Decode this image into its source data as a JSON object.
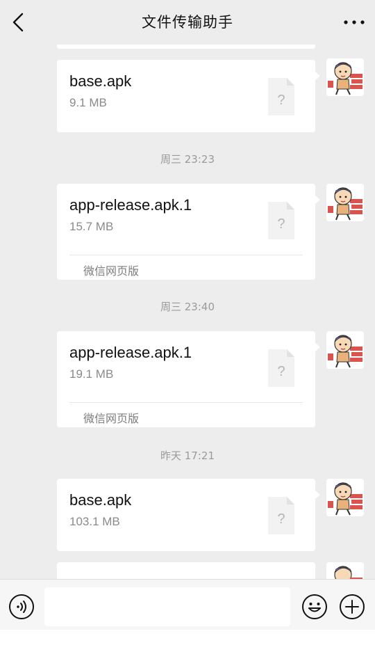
{
  "header": {
    "title": "文件传输助手",
    "back_icon": "chevron-left-icon",
    "more_icon": "more-dots-icon"
  },
  "messages": [
    {
      "file_name": "base.apk",
      "file_size": "9.1 MB",
      "source": ""
    },
    {
      "timestamp": "周三 23:23",
      "file_name": "app-release.apk.1",
      "file_size": "15.7 MB",
      "source": "微信网页版"
    },
    {
      "timestamp": "周三 23:40",
      "file_name": "app-release.apk.1",
      "file_size": "19.1 MB",
      "source": "微信网页版"
    },
    {
      "timestamp": "昨天 17:21",
      "file_name": "base.apk",
      "file_size": "103.1 MB",
      "source": ""
    }
  ],
  "file_icon_glyph": "?",
  "input_bar": {
    "voice_icon": "voice-icon",
    "emoji_icon": "emoji-icon",
    "plus_icon": "plus-circle-icon"
  },
  "colors": {
    "background": "#ededed",
    "bubble": "#ffffff",
    "muted_text": "#8a8a8a"
  }
}
